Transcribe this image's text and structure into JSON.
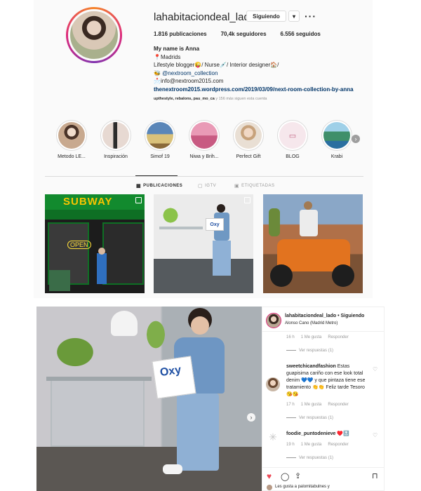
{
  "profile": {
    "username": "lahabitaciondeal_lado",
    "follow_button": "Siguiendo",
    "dropdown_icon": "▾",
    "more_icon": "···",
    "posts": "1.816 publicaciones",
    "followers": "70,4k seguidores",
    "following": "6.556 seguidos",
    "bio_name": "My name is Anna",
    "bio_lines": [
      "📍Madrids",
      "Lifestyle blogger😜/ Nurse💉/ Interior designer🏠/",
      "🐝 @nextroom_collection",
      "📩info@nextroom2015.com"
    ],
    "bio_url": "thenextroom2015.wordpress.com/2019/03/09/next-room-collection-by-anna",
    "followed_by_names": "upthestyle, rebalons, pau_mo_ca",
    "followed_by_rest": " y 156 más siguen esta cuenta"
  },
  "highlights": [
    {
      "label": "Metodo LE...",
      "color": "#c8a98f"
    },
    {
      "label": "Inspiración",
      "color": "#e7d9d2"
    },
    {
      "label": "Simof 19",
      "color": "#5a86b8"
    },
    {
      "label": "Niwa y Brih...",
      "color": "#d97b9e"
    },
    {
      "label": "Perfect Gift",
      "color": "#d8b49a"
    },
    {
      "label": "BLOG",
      "color": "#f6e7ec"
    },
    {
      "label": "Krabi",
      "color": "#3f8f6a"
    }
  ],
  "tabs": {
    "posts": "PUBLICACIONES",
    "igtv": "IGTV",
    "tagged": "ETIQUETADAS"
  },
  "post_texts": {
    "subway": "SUBWAY",
    "open": "OPEN",
    "oxy": "Oxy"
  },
  "detail": {
    "username": "lahabitaciondeal_lado",
    "follow_state": "• Siguiendo",
    "location": "Alonso Cano (Madrid Metro)",
    "comment1": {
      "time": "16 h",
      "likes": "1 Me gusta",
      "reply": "Responder",
      "view": "Ver respuestas (1)"
    },
    "comment2": {
      "user": "sweetchicandfashion",
      "text": "Estas guapisima cariño con ese look total denim 💙💙 y que pintaza tiene ese tratamiento 👏👏 Feliz tarde Tesoro 😘😘",
      "time": "17 h",
      "likes": "1 Me gusta",
      "reply": "Responder",
      "view": "Ver respuestas (1)"
    },
    "comment3": {
      "user": "foodie_puntodenieve",
      "text": "♥️🔝",
      "time": "19 h",
      "likes": "1 Me gusta",
      "reply": "Responder",
      "view": "Ver respuestas (1)"
    },
    "liked_by": "Les gusta a palomitabulnes y"
  }
}
